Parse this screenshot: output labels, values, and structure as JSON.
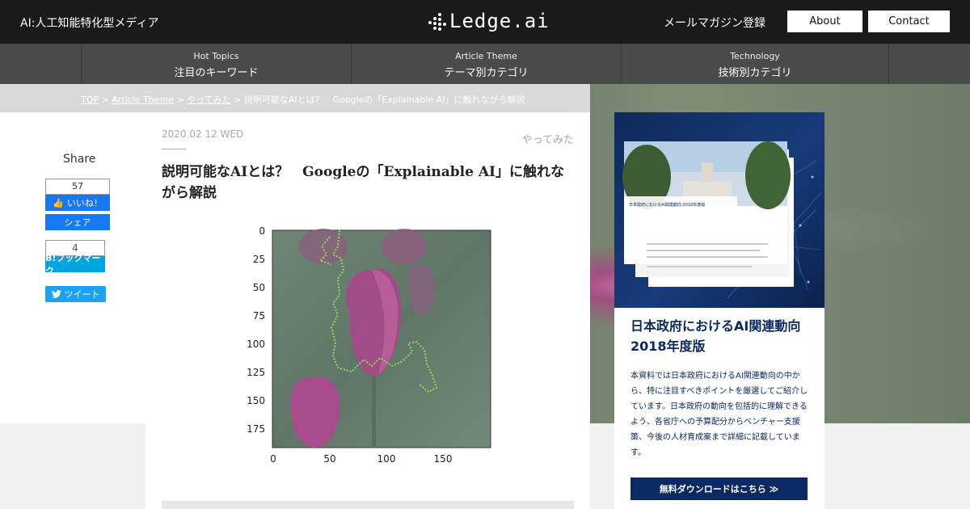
{
  "header": {
    "tagline": "AI:人工知能特化型メディア",
    "logo_text": "Ledge.ai",
    "mailmag": "メールマガジン登録",
    "about": "About",
    "contact": "Contact"
  },
  "nav": [
    {
      "en": "Hot Topics",
      "jp": "注目のキーワード"
    },
    {
      "en": "Article Theme",
      "jp": "テーマ別カテゴリ"
    },
    {
      "en": "Technology",
      "jp": "技術別カテゴリ"
    }
  ],
  "breadcrumb": {
    "top": "TOP",
    "theme": "Article Theme",
    "category": "やってみた",
    "current": "説明可能なAIとは？　Googleの「Explainable AI」に触れながら解説",
    "sep": " > "
  },
  "share": {
    "title": "Share",
    "fb_count": "57",
    "fb_like": "いいね！",
    "fb_share": "シェア",
    "hb_count": "4",
    "hb_label": "B!ブックマーク",
    "tw_label": "ツイート"
  },
  "article": {
    "date": "2020 02 12 WED",
    "category": "やってみた",
    "title": "説明可能なAIとは？　Googleの「Explainable AI」に触れながら解説"
  },
  "figure": {
    "y_ticks": [
      "0",
      "25",
      "50",
      "75",
      "100",
      "125",
      "150",
      "175"
    ],
    "x_ticks": [
      "0",
      "50",
      "100",
      "150"
    ]
  },
  "ad": {
    "report_cover_title": "日本政府におけるAI関連動向 2018年度版",
    "title_line1": "日本政府におけるAI関連動向",
    "title_line2": "2018年度版",
    "body": "本資料では日本政府におけるAI関連動向の中から、特に注目すべきポイントを厳選してご紹介しています。日本政府の動向を包括的に理解できるよう、各省庁への予算配分からベンチャー支援策、今後の人材育成案まで詳細に記載しています。",
    "cta": "無料ダウンロードはこちら ≫"
  },
  "colors": {
    "header_bg": "#1a1a1a",
    "nav_bg": "#4a4a4a",
    "facebook": "#1877f2",
    "hatena": "#00a4de",
    "twitter": "#1da1f2",
    "ad_navy": "#0b2a63"
  }
}
